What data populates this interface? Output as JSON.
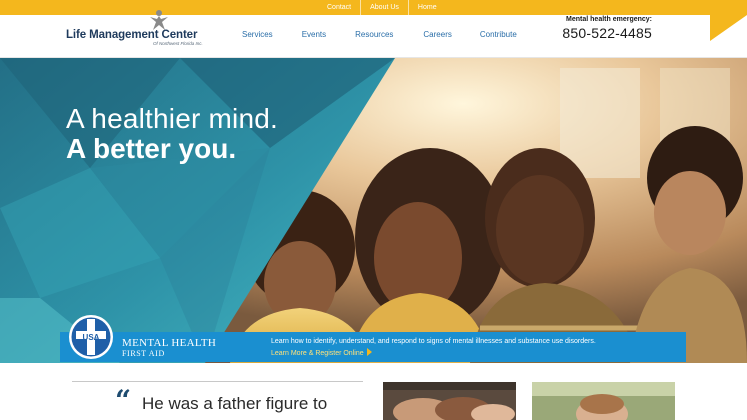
{
  "topbar": {
    "links": [
      "Contact",
      "About Us",
      "Home"
    ]
  },
  "header": {
    "logo_name": "Life Management Center",
    "logo_sub": "Of Northwest Florida Inc.",
    "nav": [
      "Services",
      "Events",
      "Resources",
      "Careers",
      "Contribute"
    ],
    "emergency_label": "Mental health emergency:",
    "emergency_phone": "850-522-4485"
  },
  "hero": {
    "headline_line1": "A healthier mind.",
    "headline_line2": "A better you."
  },
  "mhfa": {
    "badge_text": "USA",
    "title": "MENTAL HEALTH",
    "subtitle": "FIRST AID",
    "description": "Learn how to identify, understand, and respond to signs of mental illnesses and substance use disorders.",
    "cta": "Learn More & Register Online"
  },
  "testimonial": {
    "quote_mark": "“",
    "line1": "He was a father figure to",
    "line2": "..."
  },
  "colors": {
    "accent_yellow": "#f4b71d",
    "brand_navy": "#1e3a5c",
    "nav_blue": "#2a6ea8",
    "banner_blue": "#1a8fd0",
    "hero_teal": "#1f7e93"
  }
}
